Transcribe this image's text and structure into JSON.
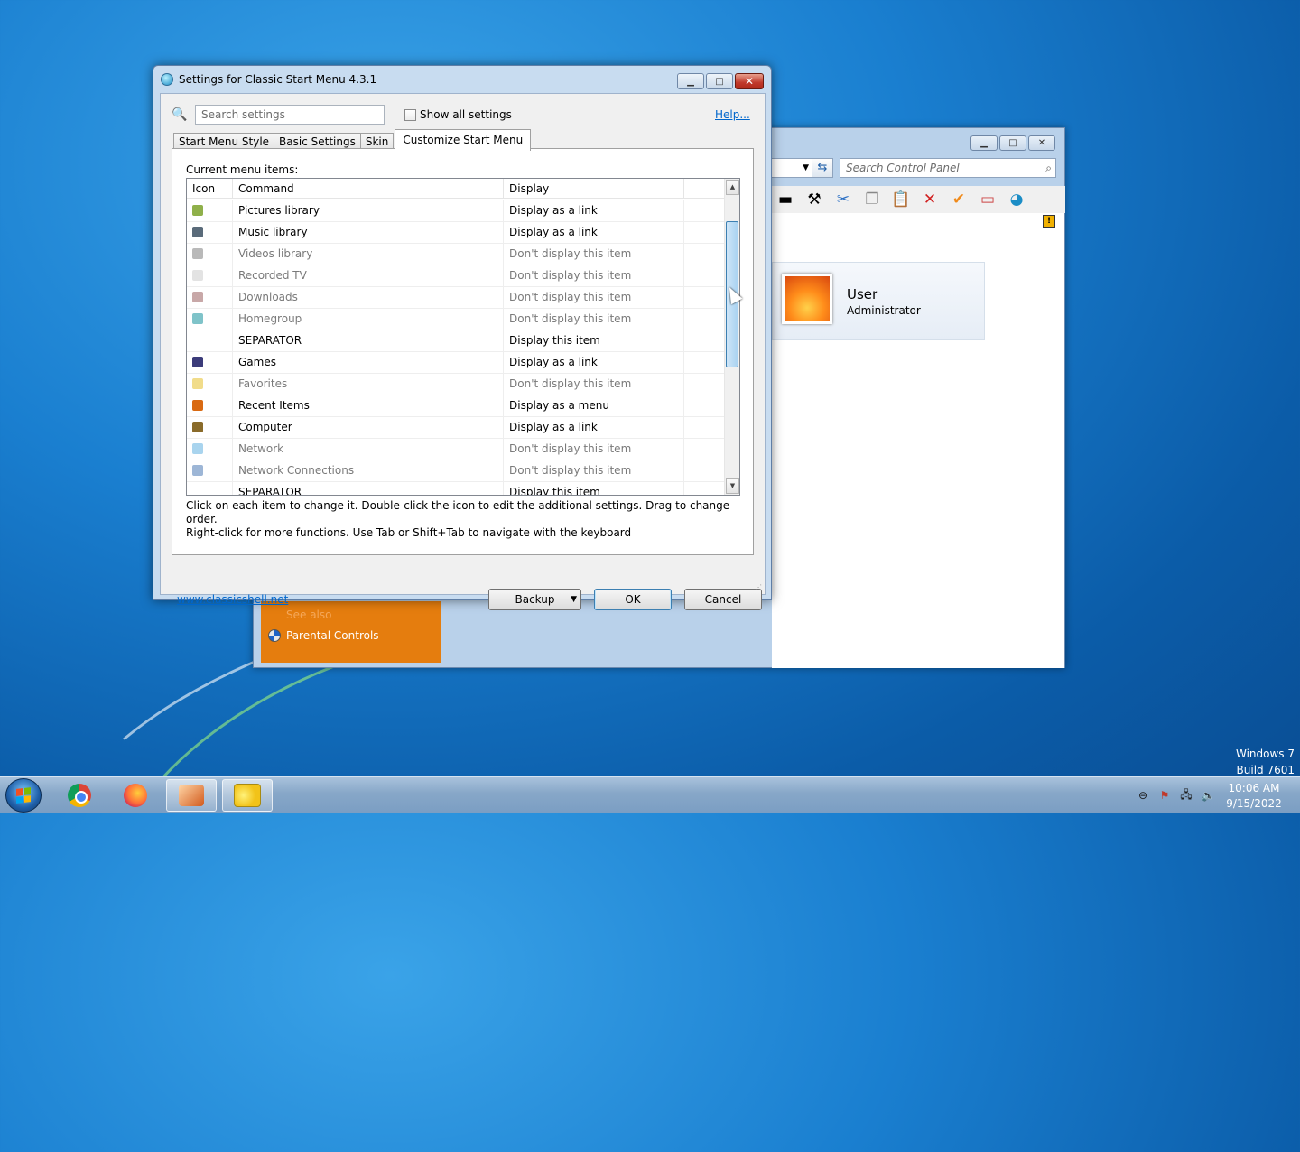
{
  "control_panel": {
    "search_placeholder": "Search Control Panel",
    "user_name": "User",
    "user_role": "Administrator",
    "see_also": "See also",
    "parental_controls": "Parental Controls"
  },
  "dialog": {
    "title": "Settings for Classic Start Menu 4.3.1",
    "search_placeholder": "Search settings",
    "show_all_label": "Show all settings",
    "help_label": "Help...",
    "tabs": [
      "Start Menu Style",
      "Basic Settings",
      "Skin",
      "Customize Start Menu"
    ],
    "current_items_label": "Current menu items:",
    "columns": {
      "icon": "Icon",
      "command": "Command",
      "display": "Display"
    },
    "rows": [
      {
        "command": "Pictures library",
        "display": "Display as a link",
        "dim": false,
        "icon_color": "#8fb04a"
      },
      {
        "command": "Music library",
        "display": "Display as a link",
        "dim": false,
        "icon_color": "#5a6b7a"
      },
      {
        "command": "Videos library",
        "display": "Don't display this item",
        "dim": true,
        "icon_color": "#b9b9b9"
      },
      {
        "command": "Recorded TV",
        "display": "Don't display this item",
        "dim": true,
        "icon_color": "#e3e3e3"
      },
      {
        "command": "Downloads",
        "display": "Don't display this item",
        "dim": true,
        "icon_color": "#c8a8a8"
      },
      {
        "command": "Homegroup",
        "display": "Don't display this item",
        "dim": true,
        "icon_color": "#7fc3c9"
      },
      {
        "command": "SEPARATOR",
        "display": "Display this item",
        "dim": false,
        "icon_color": ""
      },
      {
        "command": "Games",
        "display": "Display as a link",
        "dim": false,
        "icon_color": "#3c3c7a"
      },
      {
        "command": "Favorites",
        "display": "Don't display this item",
        "dim": true,
        "icon_color": "#f1dc8a"
      },
      {
        "command": "Recent Items",
        "display": "Display as a menu",
        "dim": false,
        "icon_color": "#d96a12"
      },
      {
        "command": "Computer",
        "display": "Display as a link",
        "dim": false,
        "icon_color": "#8a6b2a"
      },
      {
        "command": "Network",
        "display": "Don't display this item",
        "dim": true,
        "icon_color": "#a9d4ee"
      },
      {
        "command": "Network Connections",
        "display": "Don't display this item",
        "dim": true,
        "icon_color": "#9db6d6"
      },
      {
        "command": "SEPARATOR",
        "display": "Display this item",
        "dim": false,
        "icon_color": ""
      }
    ],
    "hint_line1": "Click on each item to change it. Double-click the icon to edit the additional settings. Drag to change order.",
    "hint_line2": "Right-click for more functions. Use Tab or Shift+Tab to navigate with the keyboard",
    "site_link": "www.classicshell.net",
    "backup_label": "Backup",
    "ok_label": "OK",
    "cancel_label": "Cancel"
  },
  "watermark": {
    "line1": "Windows 7",
    "line2": "Build 7601"
  },
  "clock": {
    "time": "10:06 AM",
    "date": "9/15/2022"
  }
}
